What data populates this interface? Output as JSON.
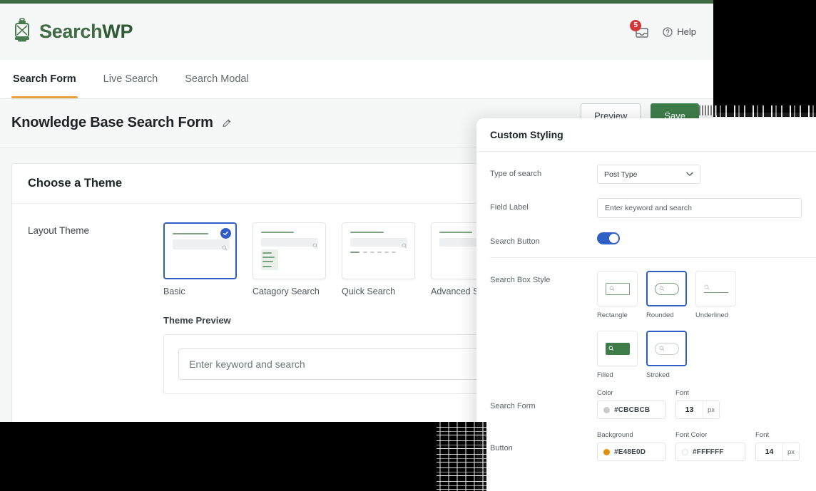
{
  "brand": {
    "name_part1": "Search",
    "name_part2": "WP",
    "logo_icon": "lantern-icon"
  },
  "header": {
    "notification_count": "5",
    "notification_icon": "inbox-icon",
    "help_label": "Help",
    "help_icon": "question-circle-icon"
  },
  "tabs": [
    {
      "label": "Search Form",
      "active": true
    },
    {
      "label": "Live Search",
      "active": false
    },
    {
      "label": "Search Modal",
      "active": false
    }
  ],
  "page": {
    "title": "Knowledge Base Search Form",
    "edit_icon": "pencil-icon",
    "secondary_button": "Preview",
    "primary_button": "Save"
  },
  "theme_card": {
    "title": "Choose a Theme",
    "layout_theme_label": "Layout Theme",
    "themes": [
      {
        "name": "Basic",
        "selected": true
      },
      {
        "name": "Catagory Search",
        "selected": false
      },
      {
        "name": "Quick Search",
        "selected": false
      },
      {
        "name": "Advanced Sea",
        "selected": false
      }
    ],
    "preview_label": "Theme Preview",
    "preview_placeholder": "Enter keyword and search"
  },
  "panel": {
    "title": "Custom Styling",
    "type_of_search": {
      "label": "Type of search",
      "value": "Post Type",
      "chevron_icon": "chevron-down-icon"
    },
    "field_label": {
      "label": "Field Label",
      "value": "Enter keyword and search"
    },
    "search_button": {
      "label": "Search Button",
      "enabled": true
    },
    "search_box_style": {
      "label": "Search Box Style",
      "options_row1": [
        {
          "name": "Rectangle",
          "selected": false,
          "icon": "search-icon"
        },
        {
          "name": "Rounded",
          "selected": true,
          "icon": "search-icon"
        },
        {
          "name": "Underlined",
          "selected": false,
          "icon": "search-icon"
        }
      ],
      "options_row2": [
        {
          "name": "Filled",
          "selected": false,
          "icon": "search-icon"
        },
        {
          "name": "Stroked",
          "selected": true,
          "icon": "search-icon"
        }
      ]
    },
    "search_form": {
      "label": "Search Form",
      "color_label": "Color",
      "color_value": "#CBCBCB",
      "font_label": "Font",
      "font_value": "13",
      "font_unit": "px"
    },
    "button": {
      "label": "Button",
      "background_label": "Background",
      "background_value": "#E48E0D",
      "font_color_label": "Font Color",
      "font_color_value": "#FFFFFF",
      "font_label": "Font",
      "font_value": "14",
      "font_unit": "px"
    }
  },
  "colors": {
    "brand_green": "#3e6b43",
    "accent_orange": "#e9a33c",
    "select_blue": "#2f5ec4",
    "badge_red": "#d63638",
    "button_green": "#3e7c4a"
  }
}
